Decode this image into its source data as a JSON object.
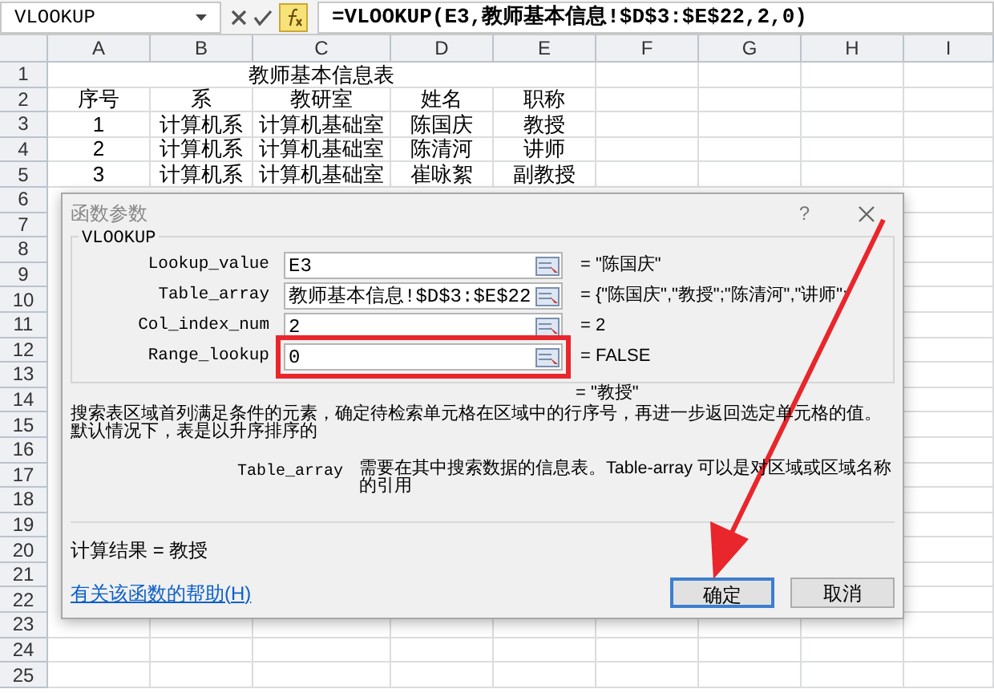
{
  "formula_bar": {
    "name_box": "VLOOKUP",
    "formula": "=VLOOKUP(E3,教师基本信息!$D$3:$E$22,2,0)"
  },
  "sheet": {
    "columns": [
      "A",
      "B",
      "C",
      "D",
      "E",
      "F",
      "G",
      "H",
      "I"
    ],
    "rows": [
      {
        "number": "1",
        "title": "教师基本信息表"
      },
      {
        "number": "2",
        "cells": [
          "序号",
          "系",
          "教研室",
          "姓名",
          "职称"
        ]
      },
      {
        "number": "3",
        "cells": [
          "1",
          "计算机系",
          "计算机基础室",
          "陈国庆",
          "教授"
        ]
      },
      {
        "number": "4",
        "cells": [
          "2",
          "计算机系",
          "计算机基础室",
          "陈清河",
          "讲师"
        ]
      },
      {
        "number": "5",
        "cells": [
          "3",
          "计算机系",
          "计算机基础室",
          "崔咏絮",
          "副教授"
        ]
      },
      {
        "number": "6"
      },
      {
        "number": "7"
      },
      {
        "number": "8"
      },
      {
        "number": "9"
      },
      {
        "number": "10"
      },
      {
        "number": "11"
      },
      {
        "number": "12"
      },
      {
        "number": "13"
      },
      {
        "number": "14"
      },
      {
        "number": "15"
      },
      {
        "number": "16"
      },
      {
        "number": "17"
      },
      {
        "number": "18"
      },
      {
        "number": "19"
      },
      {
        "number": "20"
      },
      {
        "number": "21"
      },
      {
        "number": "22"
      },
      {
        "number": "23"
      },
      {
        "number": "24"
      },
      {
        "number": "25"
      }
    ]
  },
  "dialog": {
    "title": "函数参数",
    "help": "?",
    "group_label": "VLOOKUP",
    "args": [
      {
        "name": "Lookup_value",
        "value": "E3",
        "result": "= \"陈国庆\"",
        "highlighted": false
      },
      {
        "name": "Table_array",
        "value": "教师基本信息!$D$3:$E$22",
        "result": "= {\"陈国庆\",\"教授\";\"陈清河\",\"讲师\";",
        "highlighted": false
      },
      {
        "name": "Col_index_num",
        "value": "2",
        "result": "= 2",
        "highlighted": false
      },
      {
        "name": "Range_lookup",
        "value": "0",
        "result": "= FALSE",
        "highlighted": true
      }
    ],
    "function_result": "= \"教授\"",
    "description": "搜索表区域首列满足条件的元素，确定待检索单元格在区域中的行序号，再进一步返回选定单元格的值。默认情况下，表是以升序排序的",
    "param_name": "Table_array",
    "param_description": "需要在其中搜索数据的信息表。Table-array 可以是对区域或区域名称的引用",
    "calc_result": "计算结果 = 教授",
    "help_link": "有关该函数的帮助(H)",
    "buttons": [
      {
        "label": "确定",
        "default": true
      },
      {
        "label": "取消",
        "default": false
      }
    ]
  }
}
